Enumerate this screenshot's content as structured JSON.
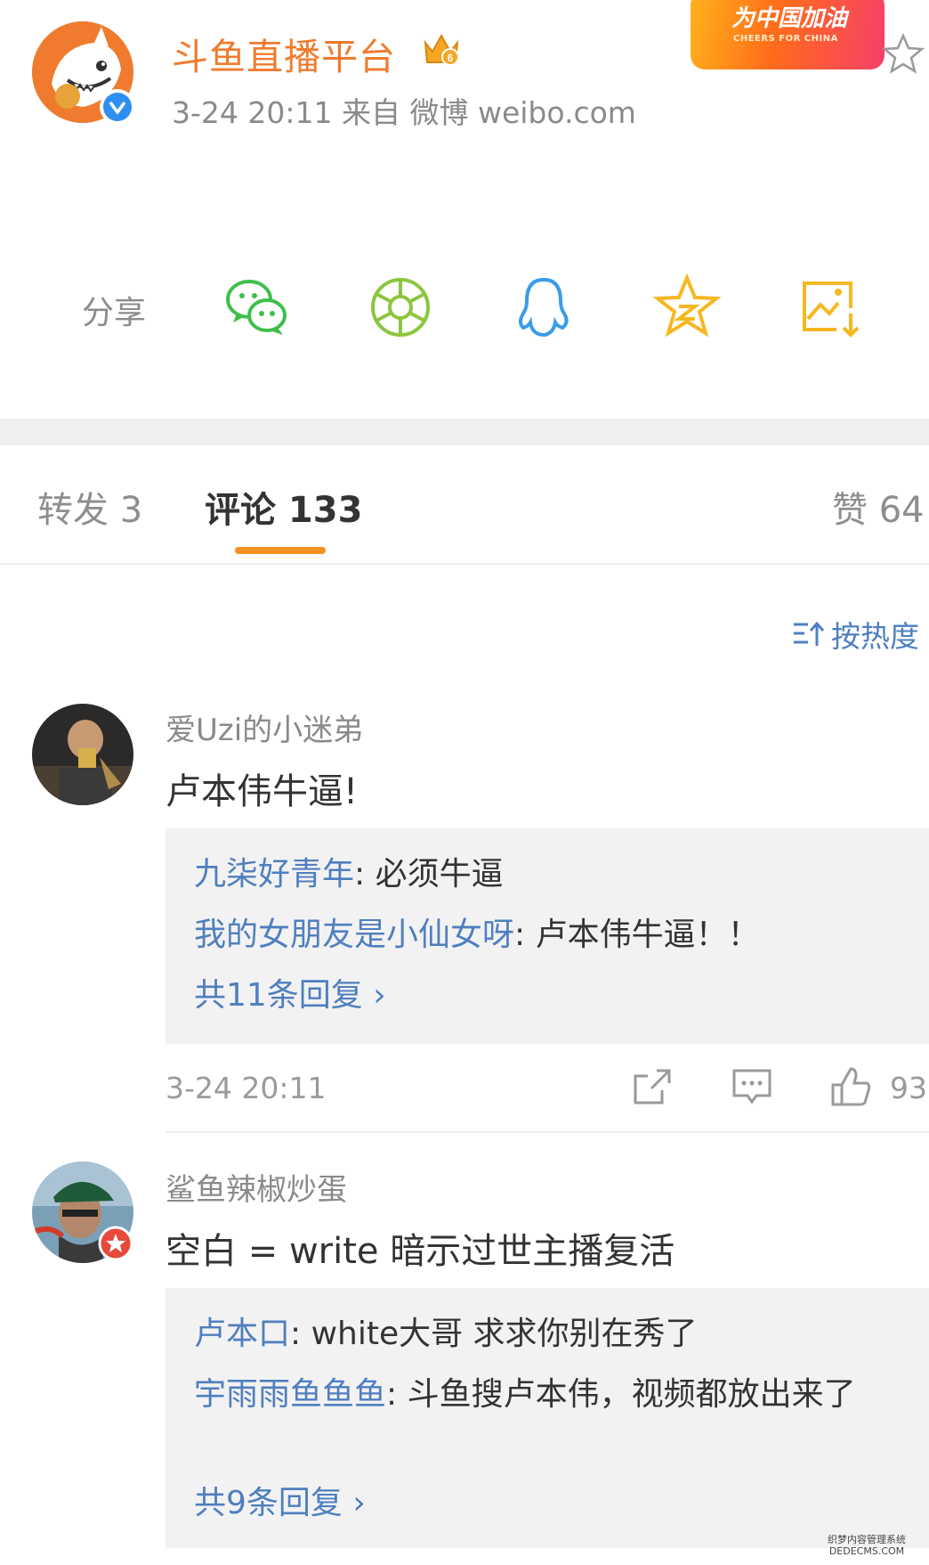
{
  "post": {
    "username": "斗鱼直播平台",
    "meta": "3-24 20:11   来自 微博 weibo.com",
    "banner_title": "为中国加油",
    "banner_subtitle": "CHEERS FOR CHINA"
  },
  "share": {
    "label": "分享",
    "icons": [
      "wechat-icon",
      "moments-icon",
      "qq-icon",
      "qzone-icon",
      "save-image-icon"
    ],
    "colors": {
      "wechat": "#3fbf4a",
      "moments": "#8cc63f",
      "qq": "#3a9be8",
      "qzone": "#f5b820",
      "save": "#f5b820"
    }
  },
  "tabs": {
    "repost": "转发 3",
    "comments": "评论 133",
    "likes": "赞 64"
  },
  "sort_label": "按热度",
  "comments": [
    {
      "user": "爱Uzi的小迷弟",
      "text": "卢本伟牛逼!",
      "replies": [
        {
          "name": "九柒好青年",
          "text": ": 必须牛逼"
        },
        {
          "name": "我的女朋友是小仙女呀",
          "text": ": 卢本伟牛逼！！"
        }
      ],
      "more": "共11条回复 ›",
      "time": "3-24 20:11",
      "likes": "93"
    },
    {
      "user": "鲨鱼辣椒炒蛋",
      "text": "空白 = write 暗示过世主播复活",
      "replies": [
        {
          "name": "卢本口",
          "text": ": white大哥 求求你别在秀了"
        },
        {
          "name": "宇雨雨鱼鱼鱼",
          "text": ": 斗鱼搜卢本伟，视频都放出来了"
        }
      ],
      "more": "共9条回复 ›"
    }
  ],
  "watermark": {
    "line1": "织梦内容管理系统",
    "line2": "DEDECMS.COM"
  },
  "colors": {
    "accent": "#f7901e",
    "link": "#4f7fbf",
    "brand_orange": "#f07b2e"
  }
}
